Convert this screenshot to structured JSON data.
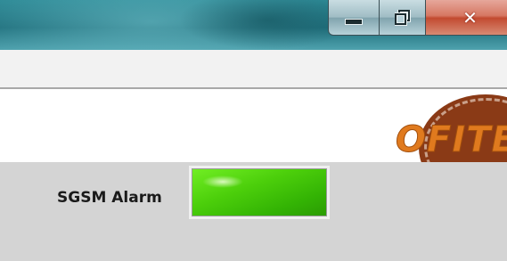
{
  "window": {
    "caption_buttons": {
      "minimize_icon": "minimize-icon",
      "maximize_icon": "restore-icon",
      "close_icon": "close-icon",
      "close_glyph": "✕"
    }
  },
  "header": {
    "logo_text": "OFITE"
  },
  "panel": {
    "alarm_label": "SGSM Alarm",
    "alarm_state_color": "#4ccf0b"
  },
  "colors": {
    "titlebar": "#1f6f7c",
    "menustrip": "#f2f2f2",
    "panel": "#d4d4d4",
    "logo_orange": "#e07a1e",
    "logo_brown": "#8a3a16",
    "led_green": "#4ccf0b"
  }
}
